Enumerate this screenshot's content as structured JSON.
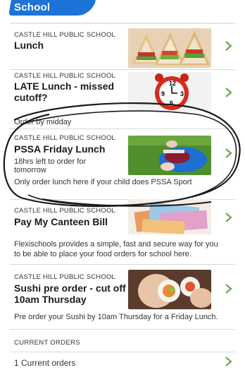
{
  "header": {
    "title": "School"
  },
  "cards": [
    {
      "school": "CASTLE HILL PUBLIC SCHOOL",
      "title": "Lunch",
      "image": "sandwiches-photo",
      "note": ""
    },
    {
      "school": "CASTLE HILL PUBLIC SCHOOL",
      "title_lines": [
        "LATE Lunch - missed",
        "cutoff?"
      ],
      "image": "alarm-clock-photo",
      "note": "Order by midday"
    },
    {
      "school": "CASTLE HILL PUBLIC SCHOOL",
      "title": "PSSA Friday Lunch",
      "sub_lines": [
        "18hrs left to order for",
        "tomorrow"
      ],
      "image": "sports-bag-photo",
      "note": "Only order lunch here if your child does PSSA Sport"
    },
    {
      "school": "CASTLE HILL PUBLIC SCHOOL",
      "title": "Pay My Canteen Bill",
      "image": "banknotes-photo",
      "note_lines": [
        "Flexischools provides a simple, fast and secure way for you",
        "to be able to place your food orders for school here."
      ]
    },
    {
      "school": "CASTLE HILL PUBLIC SCHOOL",
      "title_lines": [
        "Sushi pre order - cut off",
        "10am Thursday"
      ],
      "image": "sushi-photo",
      "note": "Pre order your Sushi by 10am Thursday for a Friday Lunch."
    }
  ],
  "current_orders": {
    "section": "CURRENT ORDERS",
    "label": "1 Current orders"
  },
  "colors": {
    "chevron": "#6aa84f",
    "divider": "#d9d9d9",
    "header_blue": "#1e73d8"
  }
}
